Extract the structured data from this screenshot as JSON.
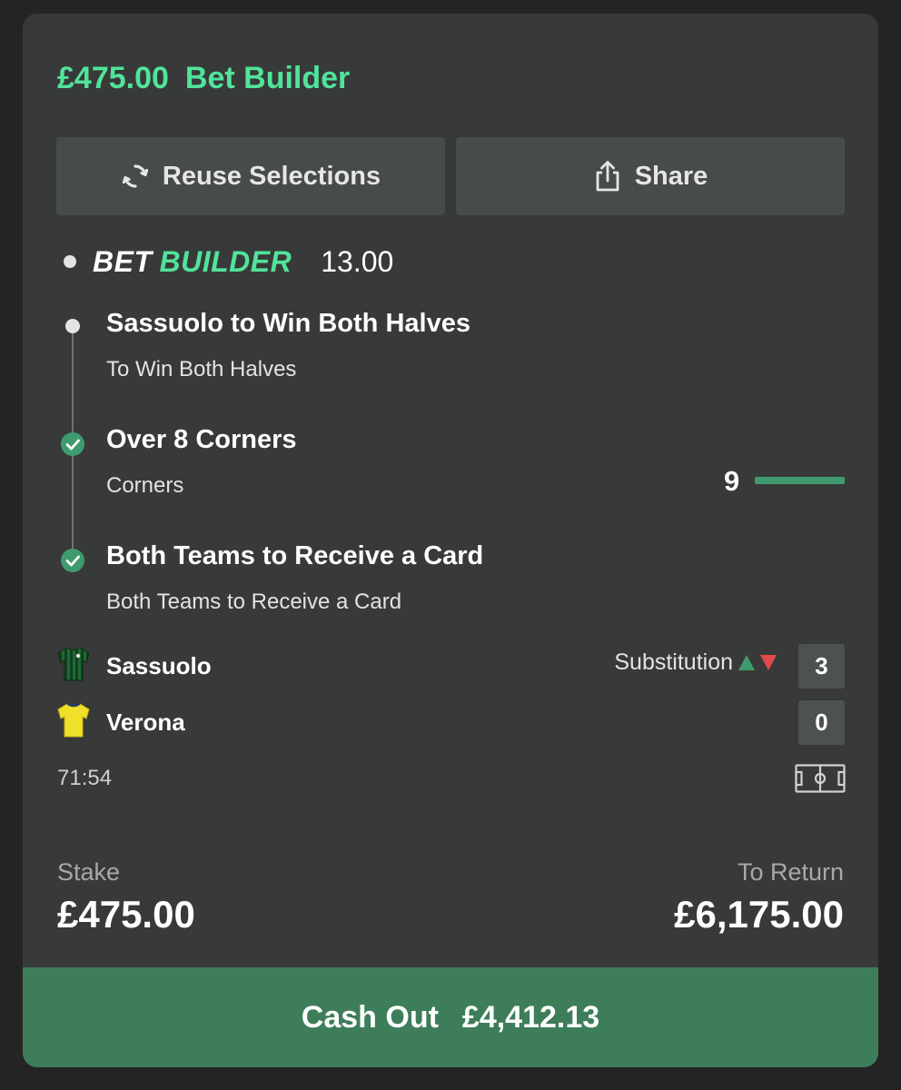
{
  "header": {
    "stake": "£475.00",
    "title": "Bet Builder"
  },
  "buttons": {
    "reuse": "Reuse Selections",
    "share": "Share"
  },
  "bet_builder": {
    "logo_bet": "BET",
    "logo_builder": "BUILDER",
    "odds": "13.00"
  },
  "selections": [
    {
      "title": "Sassuolo to Win Both Halves",
      "market": "To Win Both Halves",
      "status": "pending"
    },
    {
      "title": "Over 8 Corners",
      "market": "Corners",
      "status": "won",
      "progress_value": "9"
    },
    {
      "title": "Both Teams to Receive a Card",
      "market": "Both Teams to Receive a Card",
      "status": "won"
    }
  ],
  "match": {
    "home": {
      "name": "Sassuolo",
      "score": "3"
    },
    "away": {
      "name": "Verona",
      "score": "0"
    },
    "event": "Substitution",
    "clock": "71:54"
  },
  "footer": {
    "stake_label": "Stake",
    "stake_value": "£475.00",
    "return_label": "To Return",
    "return_value": "£6,175.00"
  },
  "cashout": {
    "label": "Cash Out",
    "amount": "£4,412.13"
  },
  "colors": {
    "accent": "#52e39a",
    "success": "#3f9b6e",
    "danger": "#e04a4a",
    "cashout_bg": "#3d7d5a"
  }
}
